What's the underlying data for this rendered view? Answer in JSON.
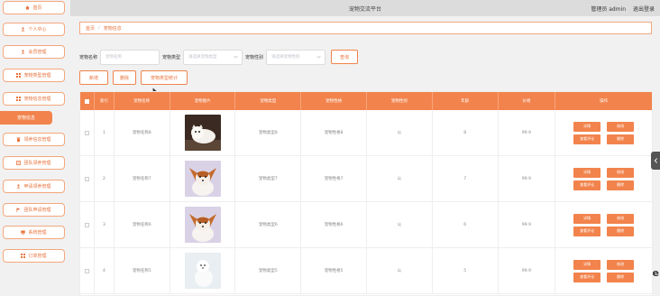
{
  "header": {
    "title": "宠物交流平台",
    "user": "管理员 admin",
    "logout": "退出登录"
  },
  "sidebar": {
    "items": [
      {
        "label": "首页",
        "icon": "home-icon"
      },
      {
        "label": "个人中心",
        "icon": "user-icon"
      },
      {
        "label": "会员管理",
        "icon": "user-icon"
      },
      {
        "label": "宠物类型管理",
        "icon": "grid-icon"
      },
      {
        "label": "宠物信息管理",
        "icon": "grid-icon"
      },
      {
        "label": "宠物信息",
        "icon": "",
        "active": true
      },
      {
        "label": "领养信息管理",
        "icon": "trash-icon"
      },
      {
        "label": "团队领养管理",
        "icon": "doc-icon"
      },
      {
        "label": "申请领养管理",
        "icon": "user-icon"
      },
      {
        "label": "团队申请管理",
        "icon": "flag-icon"
      },
      {
        "label": "系统管理",
        "icon": "monitor-icon"
      },
      {
        "label": "订单管理",
        "icon": "grid-icon"
      }
    ]
  },
  "breadcrumb": {
    "home": "首页",
    "separator": "/",
    "current": "宠物信息"
  },
  "search": {
    "name_label": "宠物名称",
    "name_placeholder": "宠物名称",
    "type_label": "宠物类型",
    "type_placeholder": "请选择宠物类型",
    "gender_label": "宠物性别",
    "gender_placeholder": "请选择宠物性别",
    "query_button": "查询"
  },
  "actions": {
    "add": "新增",
    "delete": "删除",
    "stats": "宠物类型统计"
  },
  "table": {
    "headers": [
      "",
      "索引",
      "宠物名称",
      "宠物图片",
      "宠物类型",
      "宠物性格",
      "宠物性别",
      "年龄",
      "价格",
      "操作"
    ],
    "op_labels": {
      "detail": "详情",
      "edit": "修改",
      "comments": "查看评论",
      "delete": "删除"
    },
    "rows": [
      {
        "index": "1",
        "name": "宠物名称8",
        "image": "white-persian-cat",
        "type": "宠物类型8",
        "personality": "宠物性格8",
        "gender": "公",
        "age": "8",
        "price": "99.9"
      },
      {
        "index": "2",
        "name": "宠物名称7",
        "image": "papillon-dog",
        "type": "宠物类型7",
        "personality": "宠物性格7",
        "gender": "公",
        "age": "7",
        "price": "99.9"
      },
      {
        "index": "3",
        "name": "宠物名称6",
        "image": "papillon-dog",
        "type": "宠物类型6",
        "personality": "宠物性格6",
        "gender": "公",
        "age": "6",
        "price": "99.9"
      },
      {
        "index": "4",
        "name": "宠物名称5",
        "image": "white-dog",
        "type": "宠物类型5",
        "personality": "宠物性格5",
        "gender": "公",
        "age": "5",
        "price": "99.9"
      }
    ]
  },
  "colors": {
    "accent": "#f2834c",
    "accent_text": "#e8733d",
    "header_bg": "#dcdcdc"
  },
  "edge": {
    "text": "e"
  }
}
